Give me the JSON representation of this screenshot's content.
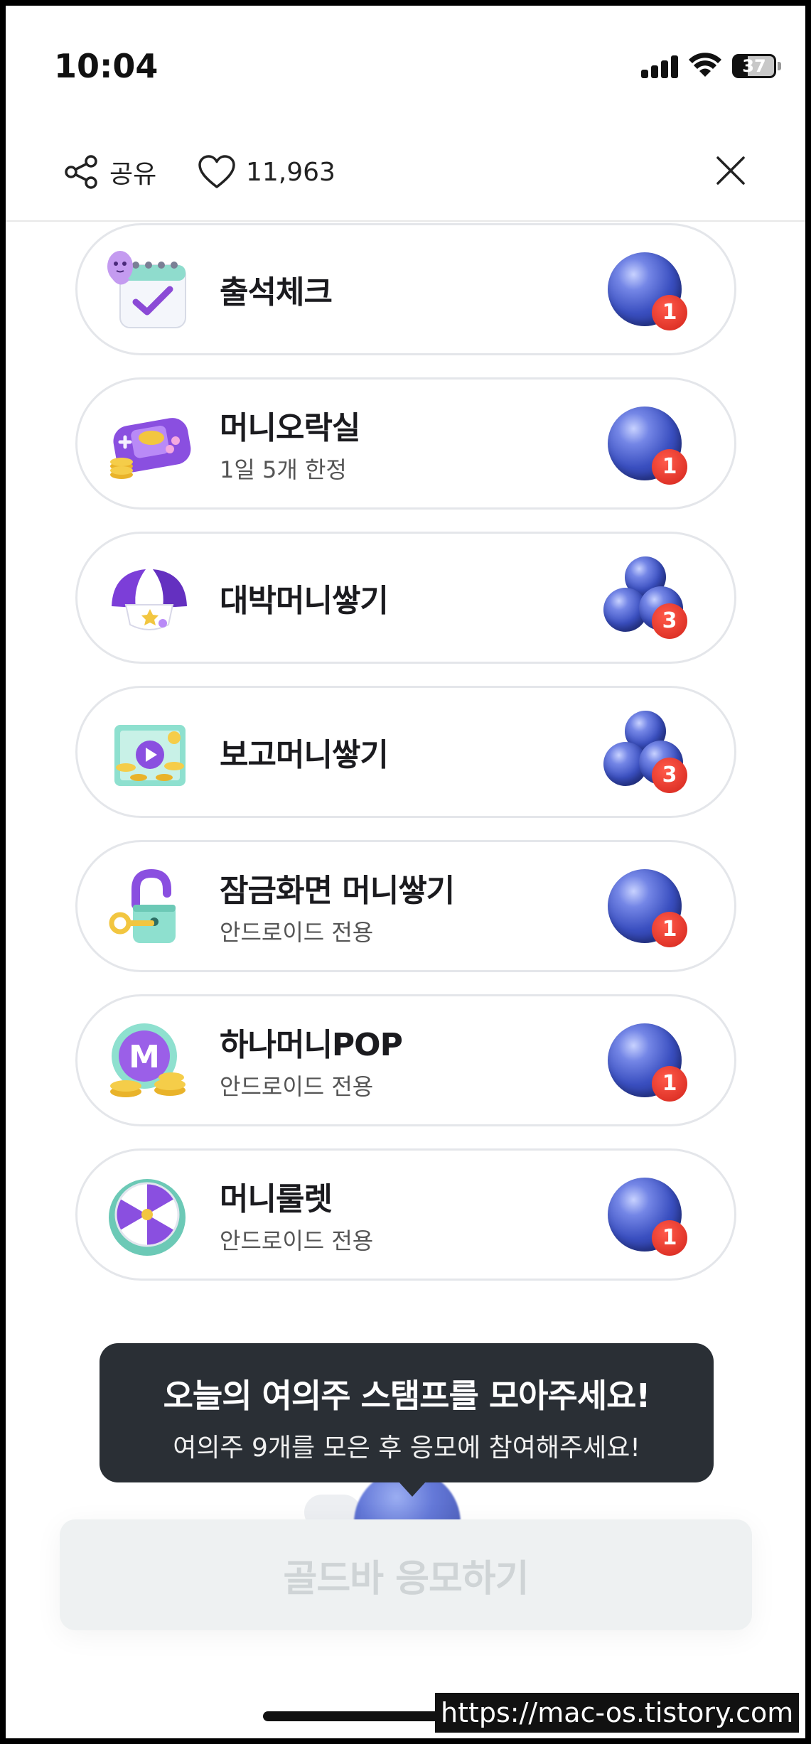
{
  "status_bar": {
    "time": "10:04",
    "battery": "37"
  },
  "header": {
    "share_label": "공유",
    "like_count": "11,963"
  },
  "items": [
    {
      "title": "출석체크",
      "subtitle": "",
      "count": "1",
      "badge": "single-ball",
      "icon": "calendar-check-icon"
    },
    {
      "title": "머니오락실",
      "subtitle": "1일 5개 한정",
      "count": "1",
      "badge": "single-ball",
      "icon": "game-console-icon"
    },
    {
      "title": "대박머니쌓기",
      "subtitle": "",
      "count": "3",
      "badge": "triple-ball",
      "icon": "surprise-egg-icon"
    },
    {
      "title": "보고머니쌓기",
      "subtitle": "",
      "count": "3",
      "badge": "triple-ball",
      "icon": "video-coins-icon"
    },
    {
      "title": "잠금화면 머니쌓기",
      "subtitle": "안드로이드 전용",
      "count": "1",
      "badge": "single-ball",
      "icon": "padlock-key-icon"
    },
    {
      "title": "하나머니POP",
      "subtitle": "안드로이드 전용",
      "count": "1",
      "badge": "single-ball",
      "icon": "money-coin-icon"
    },
    {
      "title": "머니룰렛",
      "subtitle": "안드로이드 전용",
      "count": "1",
      "badge": "single-ball",
      "icon": "roulette-icon"
    }
  ],
  "tooltip": {
    "title": "오늘의 여의주 스탬프를 모아주세요!",
    "subtitle": "여의주 9개를 모은 후 응모에 참여해주세요!"
  },
  "cta": {
    "label": "골드바 응모하기"
  },
  "watermark": "https://mac-os.tistory.com",
  "colors": {
    "tooltip_bg": "#2a2f35",
    "badge_red": "#d3241b",
    "ball_blue": "#3a4fc0",
    "cta_disabled": "#eef1f2"
  }
}
